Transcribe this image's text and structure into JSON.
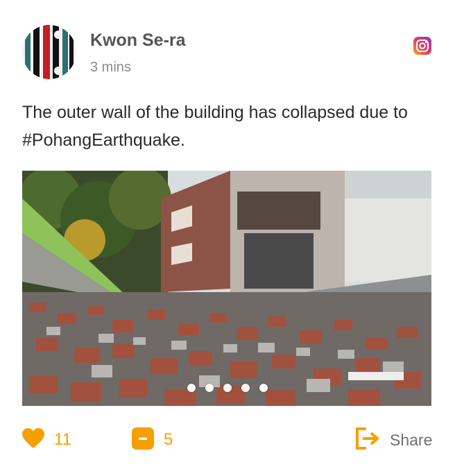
{
  "post": {
    "author": "Kwon Se-ra",
    "time": "3 mins",
    "text": "The outer wall of the building has collapsed due to #PohangEarthquake."
  },
  "icons": {
    "source": "instagram-icon",
    "like": "heart-icon",
    "comment": "comment-icon",
    "share": "share-icon"
  },
  "media": {
    "image_count": 5,
    "current_index": 1
  },
  "actions": {
    "likes": "11",
    "comments": "5",
    "share_label": "Share"
  },
  "colors": {
    "accent": "#f5a000",
    "name": "#555555",
    "muted": "#8a8a8a",
    "text": "#2a2a2a"
  }
}
